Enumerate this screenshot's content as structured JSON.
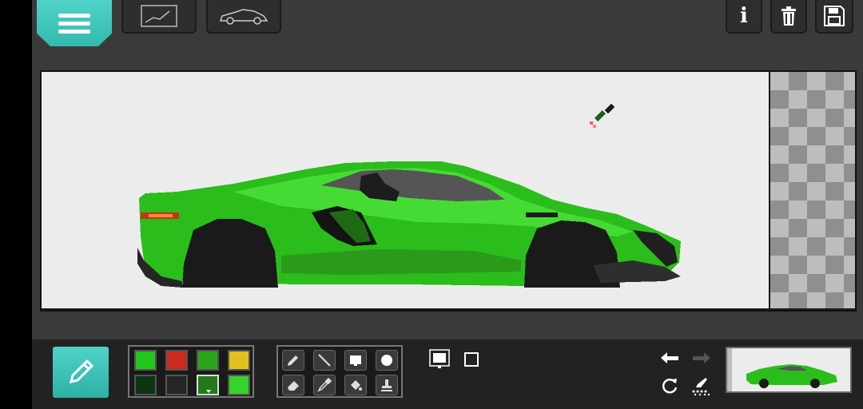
{
  "app": {
    "top_buttons": [
      "menu-button",
      "line-view-button",
      "car-view-button",
      "info-button",
      "delete-button",
      "save-button"
    ],
    "info_label": "i"
  },
  "palette": {
    "colors": [
      "#22c71b",
      "#cc2a1e",
      "#2aa61c",
      "#e3c01d",
      "#0e3512",
      "#262626",
      "#227a18",
      "#36d32a"
    ],
    "selected_index": 6
  },
  "tools": {
    "items": [
      "pencil-tool",
      "line-tool",
      "fill-rect-tool",
      "circle-tool",
      "eraser-tool",
      "eyedropper-tool",
      "bucket-tool",
      "stamp-tool"
    ]
  },
  "colors": {
    "accent": "#4fd3c9",
    "canvas_bg": "#ececec",
    "car_green": "#33cc22"
  }
}
